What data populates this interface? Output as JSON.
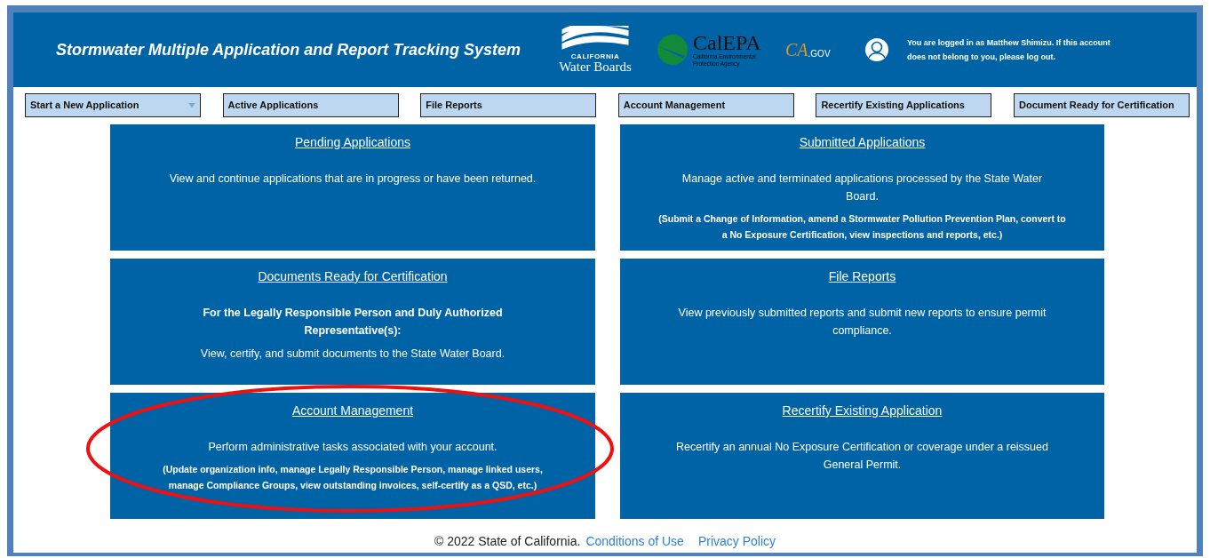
{
  "header": {
    "title": "Stormwater Multiple Application and Report Tracking System",
    "logos": [
      {
        "kind": "waterboards",
        "small": "CALIFORNIA",
        "text": "Water Boards"
      },
      {
        "kind": "calepa",
        "text": "CalEPA",
        "small": "California Environmental Protection Agency"
      },
      {
        "kind": "cagov",
        "text": "CA",
        "small": ".GOV"
      }
    ],
    "user_message": "You are logged in as Matthew Shimizu. If this account does not belong to you, please log out."
  },
  "nav": [
    {
      "label": "Start a New Application",
      "kind": "dropdown"
    },
    {
      "label": "Active Applications",
      "kind": "button"
    },
    {
      "label": "File Reports",
      "kind": "button"
    },
    {
      "label": "Account Management",
      "kind": "button"
    },
    {
      "label": "Recertify Existing Applications",
      "kind": "button"
    },
    {
      "label": "Document Ready for Certification",
      "kind": "button"
    }
  ],
  "cards": [
    {
      "title": "Pending Applications",
      "circled": false,
      "paragraphs": [
        {
          "kind": "body",
          "text": "View and continue applications that are in progress or have been returned."
        }
      ]
    },
    {
      "title": "Submitted Applications",
      "circled": false,
      "paragraphs": [
        {
          "kind": "body",
          "text": "Manage active and terminated applications processed by the State Water Board."
        },
        {
          "kind": "note",
          "text": "(Submit a Change of Information, amend a Stormwater Pollution Prevention Plan, convert to a No Exposure Certification, view inspections and reports, etc.)"
        }
      ]
    },
    {
      "title": "Documents Ready for Certification",
      "circled": false,
      "paragraphs": [
        {
          "kind": "lead",
          "text": "For the Legally Responsible Person and Duly Authorized Representative(s):"
        },
        {
          "kind": "body",
          "text": "View, certify, and submit documents to the State Water Board."
        }
      ]
    },
    {
      "title": "File Reports",
      "circled": false,
      "paragraphs": [
        {
          "kind": "body",
          "text": "View previously submitted reports and submit new reports to ensure permit compliance."
        }
      ]
    },
    {
      "title": "Account Management",
      "circled": true,
      "paragraphs": [
        {
          "kind": "body",
          "text": "Perform administrative tasks associated with your account."
        },
        {
          "kind": "note",
          "text": "(Update organization info, manage Legally Responsible Person, manage linked users, manage Compliance Groups, view outstanding invoices, self-certify as a QSD, etc.)"
        }
      ]
    },
    {
      "title": "Recertify Existing Application",
      "circled": false,
      "paragraphs": [
        {
          "kind": "body",
          "text": "Recertify an annual No Exposure Certification or coverage under a reissued General Permit."
        }
      ]
    }
  ],
  "footer": {
    "copyright": "© 2022 State of California.",
    "links": [
      "Conditions of Use",
      "Privacy Policy"
    ]
  }
}
